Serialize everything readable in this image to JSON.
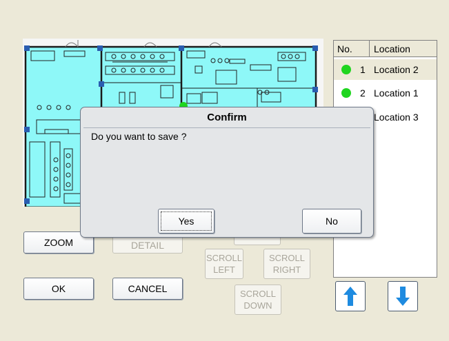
{
  "floor_plan": {
    "marker_color": "#1fd51f",
    "fill_color": "#8ef8f8"
  },
  "buttons": {
    "zoom": "ZOOM",
    "detail": "DETAIL",
    "scroll_left": "SCROLL LEFT",
    "scroll_right": "SCROLL RIGHT",
    "scroll_down": "SCROLL DOWN",
    "ok": "OK",
    "cancel": "CANCEL"
  },
  "location_table": {
    "headers": [
      "No.",
      "Location"
    ],
    "rows": [
      {
        "no": "1",
        "location": "Location 2",
        "status_color": "#1fd51f"
      },
      {
        "no": "2",
        "location": "Location 1",
        "status_color": "#1fd51f"
      },
      {
        "no": "",
        "location": "Location 3"
      }
    ]
  },
  "arrows": {
    "up": "up-arrow-icon",
    "down": "down-arrow-icon",
    "color": "#1e8be0"
  },
  "dialog": {
    "title": "Confirm",
    "message": "Do you want to save ?",
    "yes": "Yes",
    "no": "No"
  }
}
